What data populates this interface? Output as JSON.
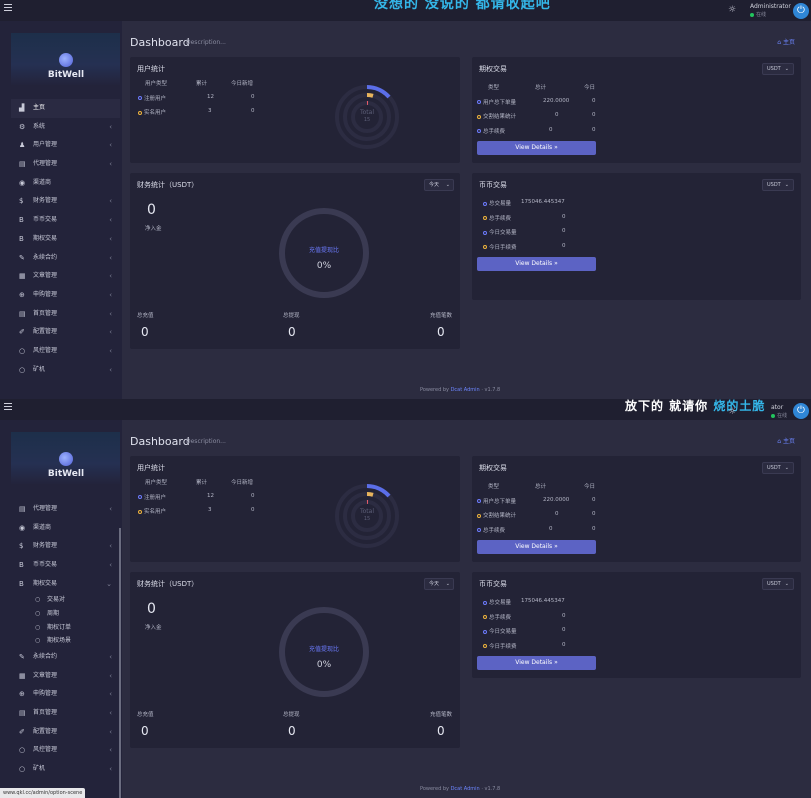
{
  "marquee": {
    "first": "没想的 没说的 都请收起吧",
    "second_a": "放下的 就请你 ",
    "second_b": "烧的土脆"
  },
  "header": {
    "user_name": "Administrator",
    "user_name_cut": "ator",
    "user_status": "在线",
    "sun_icon": "sun-icon",
    "power_icon": "power-icon"
  },
  "brand": {
    "name": "BitWell"
  },
  "menu_full": [
    {
      "label": "主页",
      "icon": "▟",
      "arrow": ""
    },
    {
      "label": "系统",
      "icon": "⚙",
      "arrow": "‹"
    },
    {
      "label": "用户管理",
      "icon": "♟",
      "arrow": "‹"
    },
    {
      "label": "代理管理",
      "icon": "▤",
      "arrow": "‹"
    },
    {
      "label": "渠道商",
      "icon": "◉",
      "arrow": ""
    },
    {
      "label": "财务管理",
      "icon": "$",
      "arrow": "‹"
    },
    {
      "label": "币币交易",
      "icon": "B",
      "arrow": "‹"
    },
    {
      "label": "期权交易",
      "icon": "B",
      "arrow": "‹"
    },
    {
      "label": "永续合约",
      "icon": "✎",
      "arrow": "‹"
    },
    {
      "label": "文章管理",
      "icon": "▦",
      "arrow": "‹"
    },
    {
      "label": "申购管理",
      "icon": "⊕",
      "arrow": "‹"
    },
    {
      "label": "首页管理",
      "icon": "▤",
      "arrow": "‹"
    },
    {
      "label": "配置管理",
      "icon": "✐",
      "arrow": "‹"
    },
    {
      "label": "风控管理",
      "icon": "○",
      "arrow": "‹"
    },
    {
      "label": "矿机",
      "icon": "○",
      "arrow": "‹"
    }
  ],
  "menu_second": [
    {
      "label": "代理管理",
      "icon": "▤",
      "arrow": "‹",
      "sub": false
    },
    {
      "label": "渠道商",
      "icon": "◉",
      "arrow": "",
      "sub": false
    },
    {
      "label": "财务管理",
      "icon": "$",
      "arrow": "‹",
      "sub": false
    },
    {
      "label": "币币交易",
      "icon": "B",
      "arrow": "‹",
      "sub": false
    },
    {
      "label": "期权交易",
      "icon": "B",
      "arrow": "⌄",
      "sub": false
    },
    {
      "label": "交易对",
      "icon": "○",
      "arrow": "",
      "sub": true
    },
    {
      "label": "周期",
      "icon": "○",
      "arrow": "",
      "sub": true
    },
    {
      "label": "期权订单",
      "icon": "○",
      "arrow": "",
      "sub": true
    },
    {
      "label": "期权场景",
      "icon": "○",
      "arrow": "",
      "sub": true
    },
    {
      "label": "永续合约",
      "icon": "✎",
      "arrow": "‹",
      "sub": false
    },
    {
      "label": "文章管理",
      "icon": "▦",
      "arrow": "‹",
      "sub": false
    },
    {
      "label": "申购管理",
      "icon": "⊕",
      "arrow": "‹",
      "sub": false
    },
    {
      "label": "首页管理",
      "icon": "▤",
      "arrow": "‹",
      "sub": false
    },
    {
      "label": "配置管理",
      "icon": "✐",
      "arrow": "‹",
      "sub": false
    },
    {
      "label": "风控管理",
      "icon": "○",
      "arrow": "‹",
      "sub": false
    },
    {
      "label": "矿机",
      "icon": "○",
      "arrow": "‹",
      "sub": false
    }
  ],
  "page": {
    "title": "Dashboard",
    "description": "Description...",
    "breadcrumb": "主页"
  },
  "user_stats": {
    "title": "用户统计",
    "headers": [
      "用户类型",
      "累计",
      "今日新增"
    ],
    "rows": [
      {
        "label": "注册用户",
        "total": "12",
        "today": "0",
        "color": "blue"
      },
      {
        "label": "实名用户",
        "total": "3",
        "today": "0",
        "color": "yellow"
      }
    ],
    "ring_label": "Total",
    "ring_value": "15"
  },
  "option_trade": {
    "title": "期权交易",
    "currency": "USDT",
    "headers": [
      "类型",
      "总计",
      "今日"
    ],
    "rows": [
      {
        "label": "用户总下单量",
        "total": "220.0000",
        "today": "0",
        "color": "blue"
      },
      {
        "label": "交割结果统计",
        "total": "0",
        "today": "0",
        "color": "yellow"
      },
      {
        "label": "总手续费",
        "total": "0",
        "today": "0",
        "color": "blue"
      }
    ],
    "button": "View Details »"
  },
  "finance": {
    "title": "财务统计（USDT）",
    "period": "今天",
    "net_value": "0",
    "net_label": "净入金",
    "ring_label": "充值提现比",
    "ring_value": "0%",
    "footer": [
      {
        "label": "总充值",
        "value": "0"
      },
      {
        "label": "总提现",
        "value": "0"
      },
      {
        "label": "充值笔数",
        "value": "0"
      }
    ]
  },
  "coin_trade": {
    "title": "币币交易",
    "currency": "USDT",
    "rows": [
      {
        "label": "总交易量",
        "value": "175046.445347",
        "color": "blue"
      },
      {
        "label": "总手续费",
        "value": "0",
        "color": "yellow"
      },
      {
        "label": "今日交易量",
        "value": "0",
        "color": "blue"
      },
      {
        "label": "今日手续费",
        "value": "0",
        "color": "yellow"
      }
    ],
    "button": "View Details »"
  },
  "footer": {
    "powered": "Powered by",
    "link": "Dcat Admin",
    "version": "· v1.7.8"
  },
  "status_url": "www.qkl.cc/admin/option-scene",
  "colors": {
    "accent": "#5c63c4",
    "bg": "#2c2c40",
    "card": "#232336",
    "ring_blue": "#5b6ee8",
    "ring_yellow": "#e8b45c",
    "ring_red": "#e85c6a"
  }
}
